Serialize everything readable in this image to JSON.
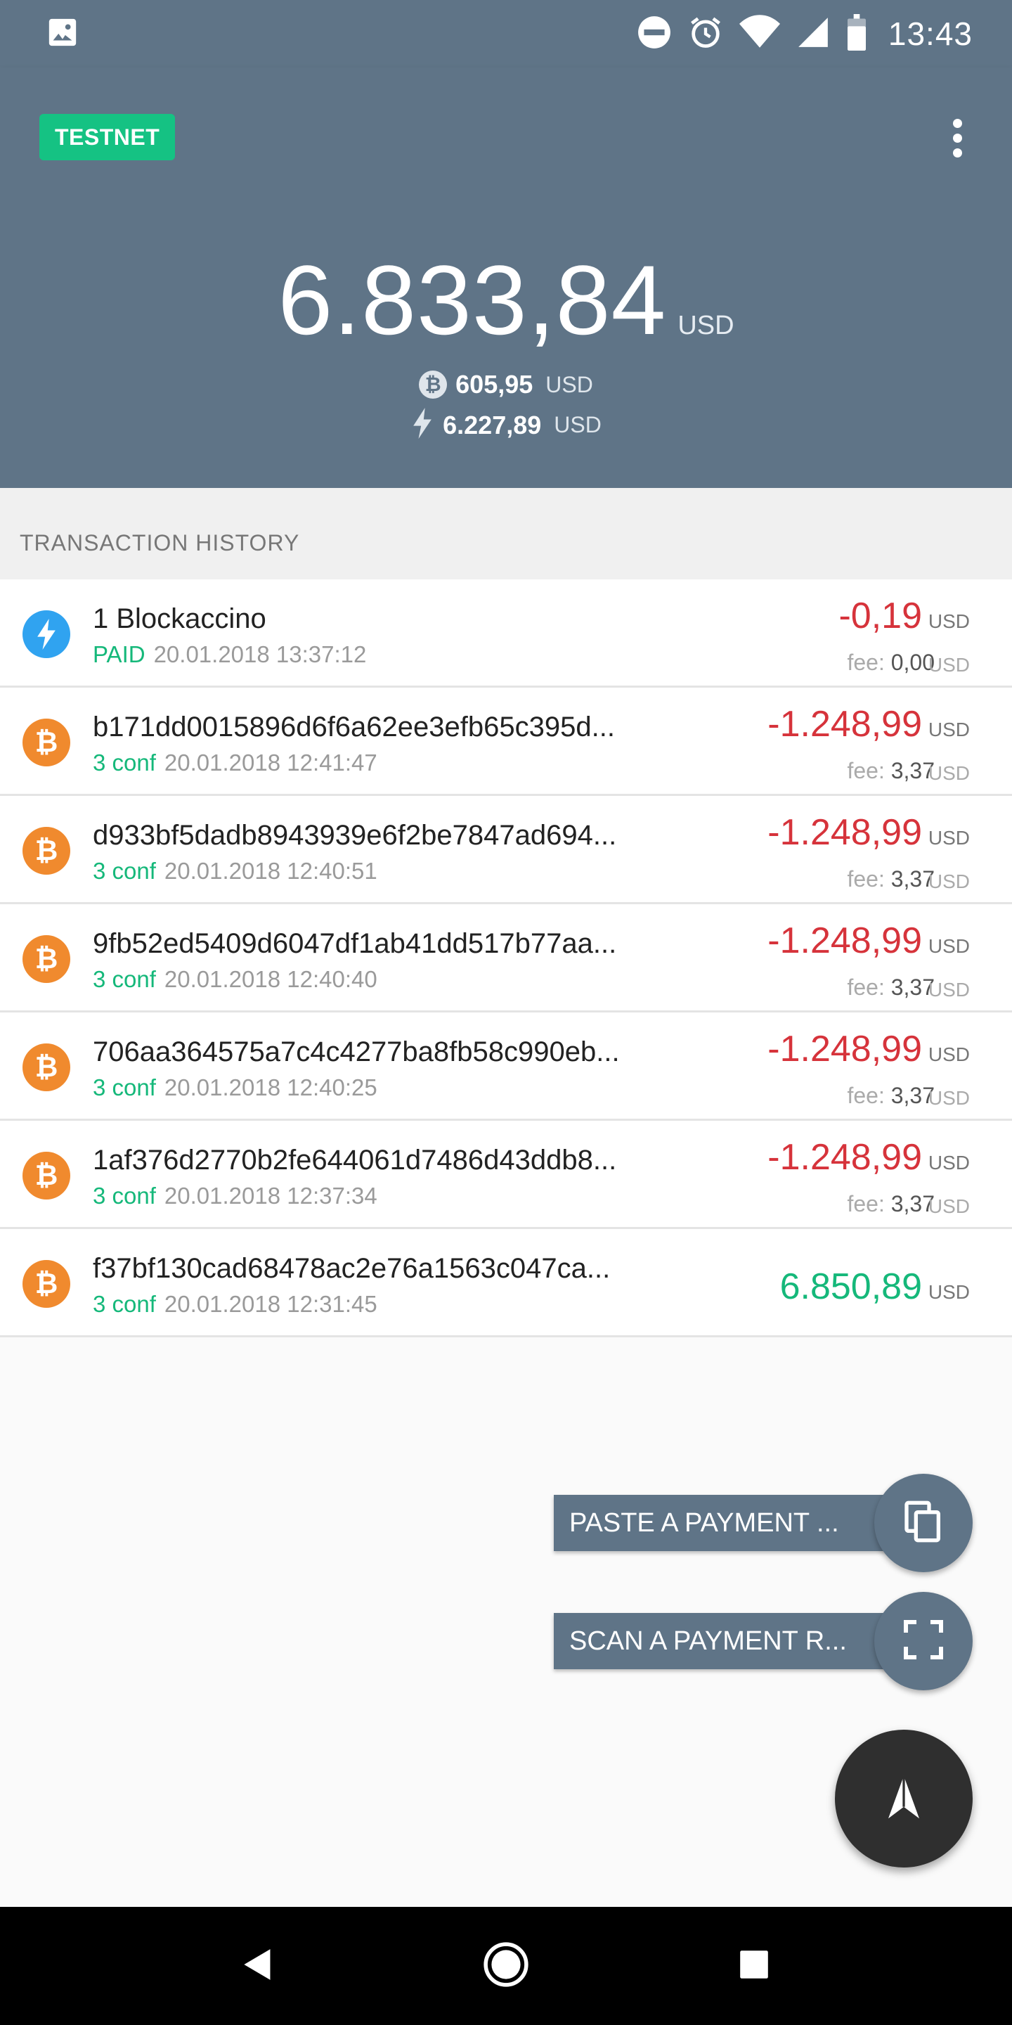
{
  "status_bar": {
    "time": "13:43",
    "icons": [
      "image-icon",
      "do-not-disturb-icon",
      "alarm-icon",
      "wifi-icon",
      "signal-icon",
      "battery-icon"
    ]
  },
  "header": {
    "network_badge": "TESTNET",
    "total_balance": "6.833,84",
    "total_unit": "USD",
    "onchain_balance": "605,95",
    "onchain_unit": "USD",
    "lightning_balance": "6.227,89",
    "lightning_unit": "USD",
    "background_color": "#5f7487",
    "badge_color": "#15c283"
  },
  "section": {
    "title": "TRANSACTION HISTORY"
  },
  "transactions": [
    {
      "type": "lightning",
      "name": "1 Blockaccino",
      "status": "PAID",
      "date": "20.01.2018 13:37:12",
      "amount": "-0,19",
      "unit": "USD",
      "fee_label": "fee:",
      "fee": "0,00",
      "fee_unit": "USD"
    },
    {
      "type": "bitcoin",
      "name": "b171dd0015896d6f6a62ee3efb65c395d...",
      "status": "3 conf",
      "date": "20.01.2018 12:41:47",
      "amount": "-1.248,99",
      "unit": "USD",
      "fee_label": "fee:",
      "fee": "3,37",
      "fee_unit": "USD"
    },
    {
      "type": "bitcoin",
      "name": "d933bf5dadb8943939e6f2be7847ad694...",
      "status": "3 conf",
      "date": "20.01.2018 12:40:51",
      "amount": "-1.248,99",
      "unit": "USD",
      "fee_label": "fee:",
      "fee": "3,37",
      "fee_unit": "USD"
    },
    {
      "type": "bitcoin",
      "name": "9fb52ed5409d6047df1ab41dd517b77aa...",
      "status": "3 conf",
      "date": "20.01.2018 12:40:40",
      "amount": "-1.248,99",
      "unit": "USD",
      "fee_label": "fee:",
      "fee": "3,37",
      "fee_unit": "USD"
    },
    {
      "type": "bitcoin",
      "name": "706aa364575a7c4c4277ba8fb58c990eb...",
      "status": "3 conf",
      "date": "20.01.2018 12:40:25",
      "amount": "-1.248,99",
      "unit": "USD",
      "fee_label": "fee:",
      "fee": "3,37",
      "fee_unit": "USD"
    },
    {
      "type": "bitcoin",
      "name": "1af376d2770b2fe644061d7486d43ddb8...",
      "status": "3 conf",
      "date": "20.01.2018 12:37:34",
      "amount": "-1.248,99",
      "unit": "USD",
      "fee_label": "fee:",
      "fee": "3,37",
      "fee_unit": "USD"
    },
    {
      "type": "bitcoin",
      "name": "f37bf130cad68478ac2e76a1563c047ca...",
      "status": "3 conf",
      "date": "20.01.2018 12:31:45",
      "amount": "6.850,89",
      "unit": "USD"
    }
  ],
  "fab": {
    "paste_label": "PASTE A PAYMENT ...",
    "scan_label": "SCAN A PAYMENT R...",
    "main_icon": "send-arrow-icon"
  },
  "colors": {
    "negative": "#d6333b",
    "positive": "#15b87a",
    "bitcoin": "#f08a2e",
    "lightning": "#30a3f0"
  }
}
